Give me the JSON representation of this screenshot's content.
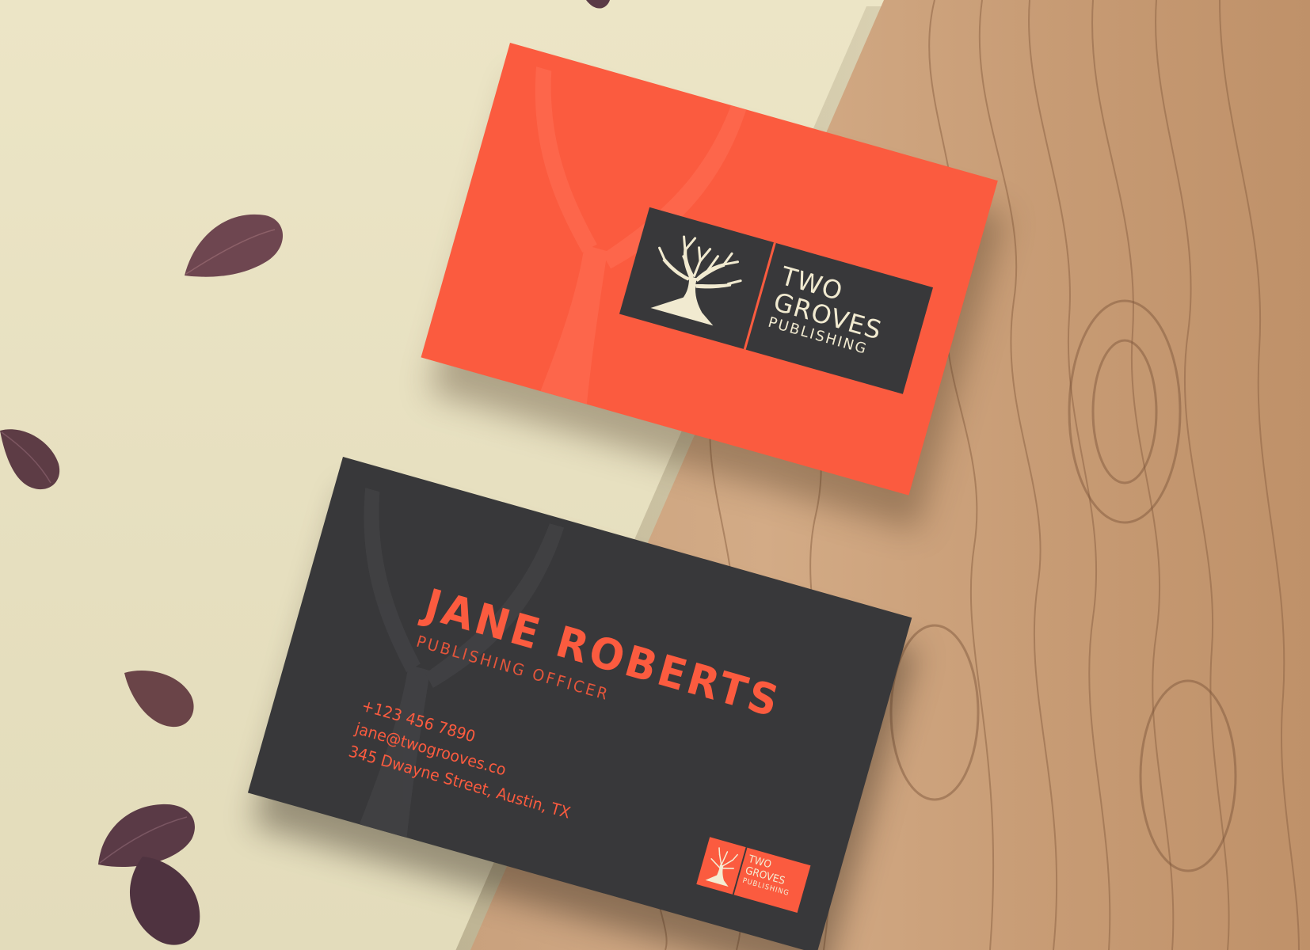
{
  "front_card": {
    "logo_lines": [
      "TWO",
      "GROVES",
      "PUBLISHING"
    ],
    "colors": {
      "card": "#fb5b3f",
      "logo_box": "#38383a",
      "logo_text": "#f1ead0"
    }
  },
  "back_card": {
    "name": "JANE ROBERTS",
    "job_title": "PUBLISHING OFFICER",
    "phone": "+123 456 7890",
    "email": "jane@twogrooves.co",
    "address": "345 Dwayne Street, Austin, TX",
    "mini_logo_lines": [
      "TWO",
      "GROVES",
      "PUBLISHING"
    ],
    "colors": {
      "card": "#38383a",
      "accent": "#fb5b3f"
    }
  },
  "background": {
    "paper_color": "#e9e2c1",
    "wood_color": "#c79a75",
    "petal_color": "#6e4650"
  },
  "icons": [
    "tree-logo-icon",
    "petal-icon"
  ]
}
